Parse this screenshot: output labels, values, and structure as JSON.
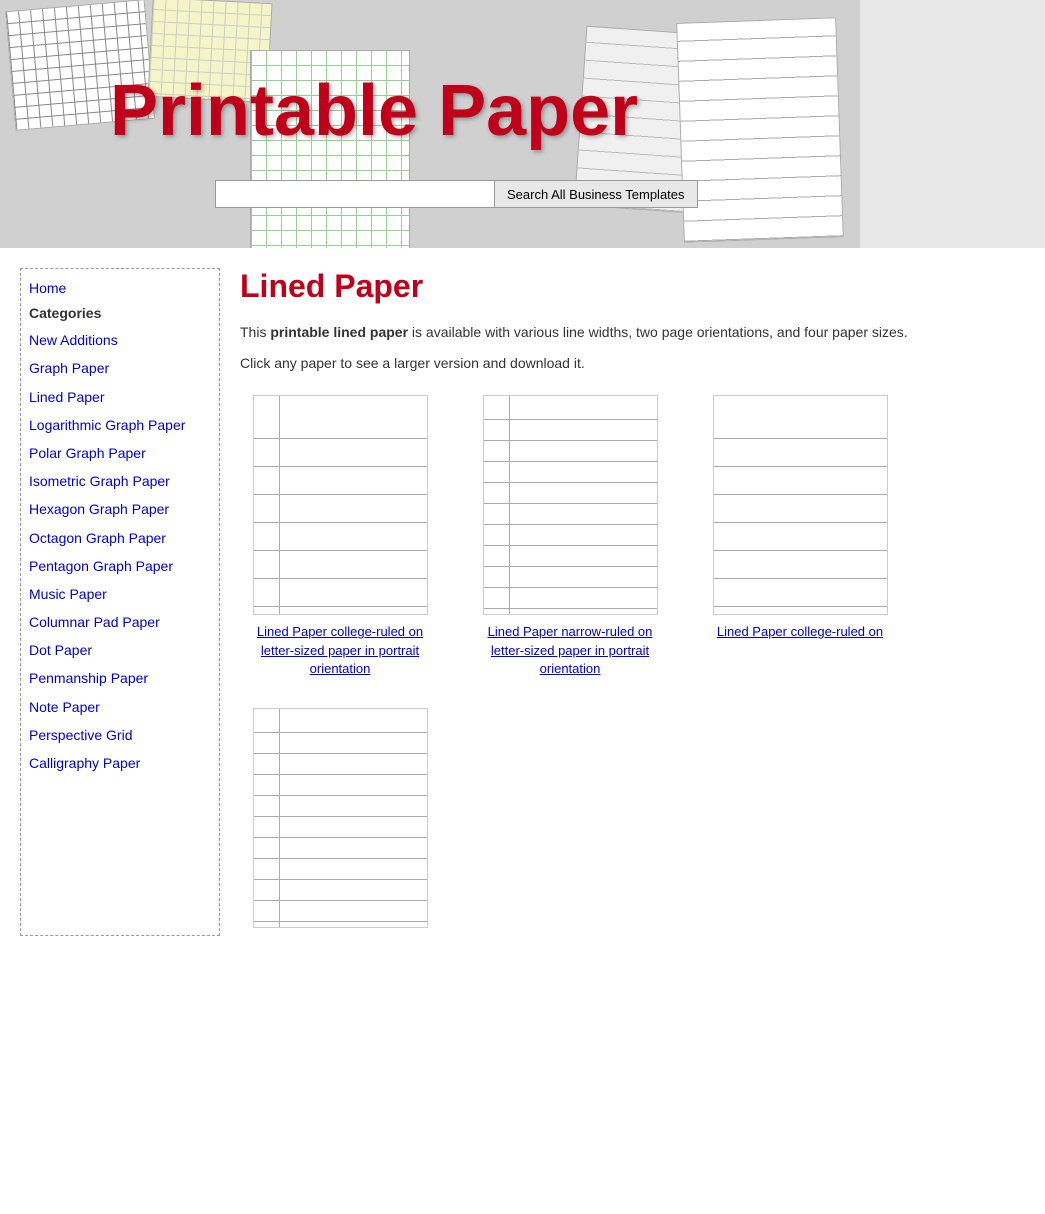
{
  "header": {
    "title": "Printable Paper",
    "search_placeholder": "",
    "search_button": "Search All Business Templates"
  },
  "sidebar": {
    "home_label": "Home",
    "categories_label": "Categories",
    "nav_items": [
      {
        "id": "new-additions",
        "label": "New Additions"
      },
      {
        "id": "graph-paper",
        "label": "Graph Paper"
      },
      {
        "id": "lined-paper",
        "label": "Lined Paper"
      },
      {
        "id": "logarithmic-graph-paper",
        "label": "Logarithmic Graph Paper"
      },
      {
        "id": "polar-graph-paper",
        "label": "Polar Graph Paper"
      },
      {
        "id": "isometric-graph-paper",
        "label": "Isometric Graph Paper"
      },
      {
        "id": "hexagon-graph-paper",
        "label": "Hexagon Graph Paper"
      },
      {
        "id": "octagon-graph-paper",
        "label": "Octagon Graph Paper"
      },
      {
        "id": "pentagon-graph-paper",
        "label": "Pentagon Graph Paper"
      },
      {
        "id": "music-paper",
        "label": "Music Paper"
      },
      {
        "id": "columnar-pad-paper",
        "label": "Columnar Pad Paper"
      },
      {
        "id": "dot-paper",
        "label": "Dot Paper"
      },
      {
        "id": "penmanship-paper",
        "label": "Penmanship Paper"
      },
      {
        "id": "note-paper",
        "label": "Note Paper"
      },
      {
        "id": "perspective-grid",
        "label": "Perspective Grid"
      },
      {
        "id": "calligraphy-paper",
        "label": "Calligraphy Paper"
      }
    ]
  },
  "main": {
    "page_title": "Lined Paper",
    "description_intro": "This ",
    "description_bold": "printable lined paper",
    "description_rest": " is available with various line widths, two page orientations, and four paper sizes.",
    "click_text": "Click any paper to see a larger version and download it.",
    "papers": [
      {
        "id": "college-portrait",
        "style": "college-ruled",
        "caption": "Lined Paper college-ruled on letter-sized paper in portrait orientation"
      },
      {
        "id": "narrow-portrait",
        "style": "narrow-ruled",
        "caption": "Lined Paper narrow-ruled on letter-sized paper in portrait orientation"
      },
      {
        "id": "college-landscape",
        "style": "college-ruled-2",
        "caption": "Lined Paper college-ruled on"
      },
      {
        "id": "narrow-landscape",
        "style": "narrow-ruled-2",
        "caption": ""
      }
    ]
  }
}
